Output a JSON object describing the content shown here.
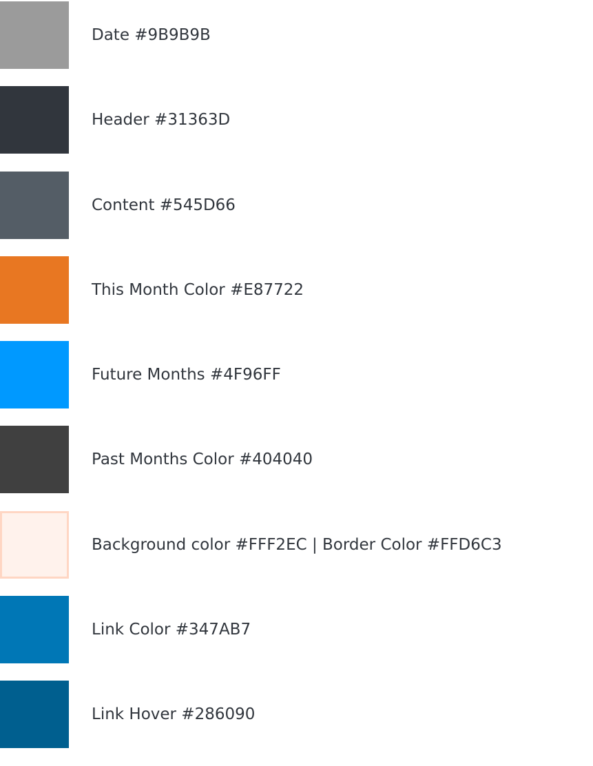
{
  "swatches": [
    {
      "label": "Date #9B9B9B",
      "color": "#9B9B9B"
    },
    {
      "label": "Header #31363D",
      "color": "#31363D"
    },
    {
      "label": "Content #545D66",
      "color": "#545D66"
    },
    {
      "label": "This Month Color #E87722",
      "color": "#E87722"
    },
    {
      "label": "Future Months #4F96FF",
      "color": "#0099FF"
    },
    {
      "label": "Past Months Color #404040",
      "color": "#404040"
    },
    {
      "label": "Background color #FFF2EC  |  Border Color #FFD6C3",
      "color": "#FFF2EC",
      "border": "#FFD6C3"
    },
    {
      "label": "Link Color #347AB7",
      "color": "#0077B6"
    },
    {
      "label": "Link Hover #286090",
      "color": "#005F8F"
    }
  ]
}
